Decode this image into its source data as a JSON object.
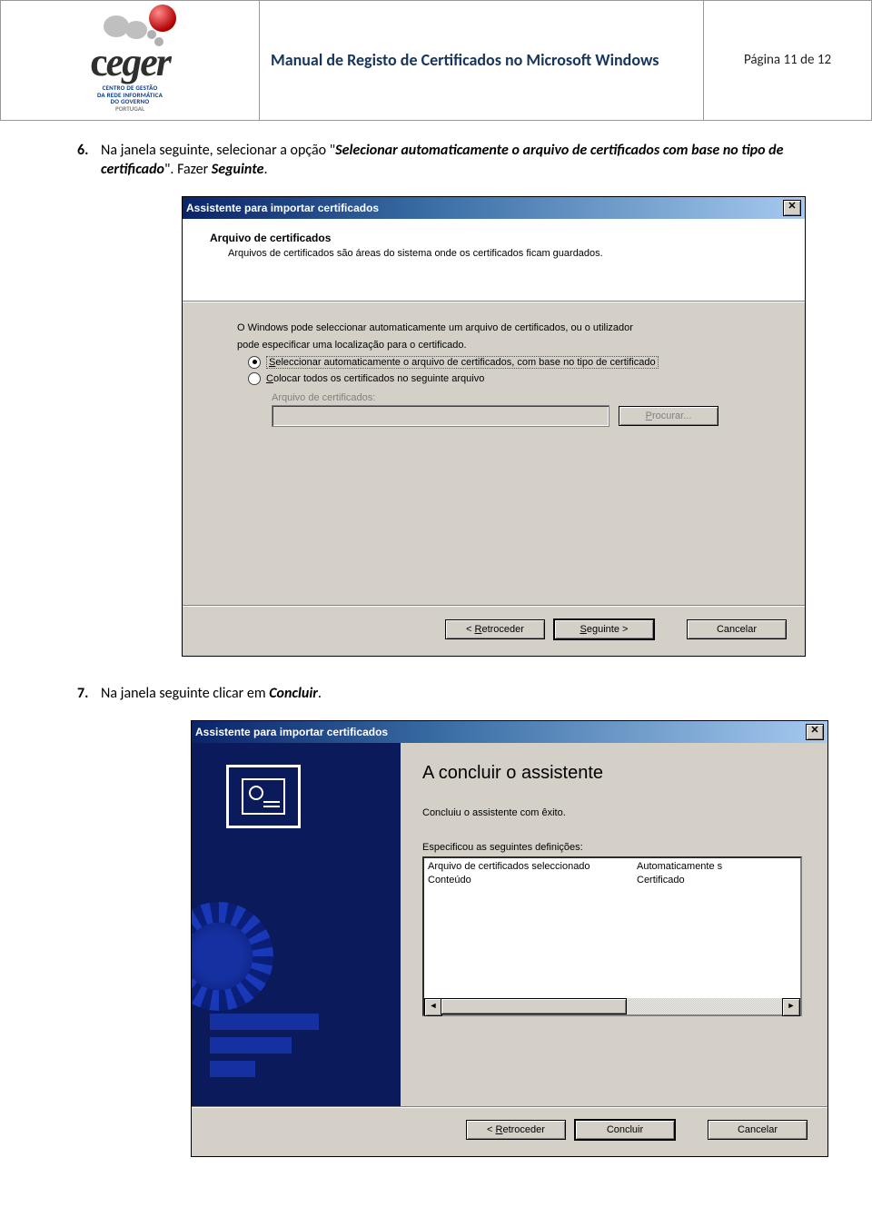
{
  "header": {
    "title": "Manual de Registo de Certificados no Microsoft Windows",
    "page_label": "Página 11 de 12",
    "logo": {
      "name": "ceger",
      "sub1": "CENTRO DE GESTÃO",
      "sub2": "DA REDE INFORMÁTICA",
      "sub3": "DO GOVERNO",
      "sub4": "PORTUGAL"
    }
  },
  "step6": {
    "num": "6.",
    "text_pre": "Na janela seguinte, selecionar a opção \"",
    "text_em": "Selecionar automaticamente o arquivo de certificados com base no tipo de certificado",
    "text_post": "\". Fazer ",
    "text_post_em": "Seguinte",
    "text_end": "."
  },
  "dialog1": {
    "title": "Assistente para importar certificados",
    "panel_heading": "Arquivo de certificados",
    "panel_sub": "Arquivos de certificados são áreas do sistema onde os certificados ficam guardados.",
    "intro_l1": "O Windows pode seleccionar automaticamente um arquivo de certificados, ou o utilizador",
    "intro_l2": "pode especificar uma localização para o certificado.",
    "opt1_pre": "S",
    "opt1_rest": "eleccionar automaticamente o arquivo de certificados, com base no tipo de certificado",
    "opt2_pre": "C",
    "opt2_rest": "olocar todos os certificados no seguinte arquivo",
    "field_label": "Arquivo de certificados:",
    "browse_pre": "P",
    "browse_rest": "rocurar...",
    "back_pre": "< ",
    "back_u": "R",
    "back_rest": "etroceder",
    "next_u": "S",
    "next_rest": "eguinte >",
    "cancel": "Cancelar"
  },
  "step7": {
    "num": "7.",
    "text_pre": "Na janela seguinte clicar em ",
    "text_em": "Concluir",
    "text_end": "."
  },
  "dialog2": {
    "title": "Assistente para importar certificados",
    "heading": "A concluir o assistente",
    "sub": "Concluiu o assistente com êxito.",
    "spec_label": "Especificou as seguintes definições:",
    "col1_r1": "Arquivo de certificados seleccionado",
    "col1_r2": "Conteúdo",
    "col2_r1": "Automaticamente s",
    "col2_r2": "Certificado",
    "back_pre": "< ",
    "back_u": "R",
    "back_rest": "etroceder",
    "finish": "Concluir",
    "cancel": "Cancelar"
  }
}
